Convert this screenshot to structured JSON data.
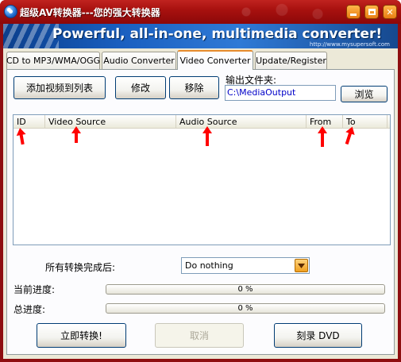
{
  "window": {
    "title": "超级AV转换器---您的强大转换器",
    "banner_text": "Powerful, all-in-one, multimedia converter!",
    "banner_url": "http://www.mysupersoft.com"
  },
  "tabs": [
    {
      "label": "CD to MP3/WMA/OGG",
      "active": false
    },
    {
      "label": "Audio Converter",
      "active": false
    },
    {
      "label": "Video Converter",
      "active": true
    },
    {
      "label": "Update/Register",
      "active": false
    }
  ],
  "toolbar": {
    "add_label": "添加视频到列表",
    "modify_label": "修改",
    "remove_label": "移除"
  },
  "output": {
    "label": "输出文件夹:",
    "path": "C:\\MediaOutput",
    "browse_label": "浏览"
  },
  "list": {
    "columns": [
      "ID",
      "Video Source",
      "Audio Source",
      "From",
      "To"
    ],
    "rows": []
  },
  "after_done": {
    "label": "所有转换完成后:",
    "selected": "Do nothing"
  },
  "progress": {
    "current_label": "当前进度:",
    "current_value": 0,
    "current_text": "0 %",
    "total_label": "总进度:",
    "total_value": 0,
    "total_text": "0 %"
  },
  "actions": {
    "convert_label": "立即转换!",
    "cancel_label": "取消",
    "burn_label": "刻录 DVD"
  },
  "colors": {
    "titlebar": "#a8110f",
    "banner": "#1a5fc0",
    "panel": "#ece9d8",
    "annotation_arrow": "#ff0000"
  }
}
